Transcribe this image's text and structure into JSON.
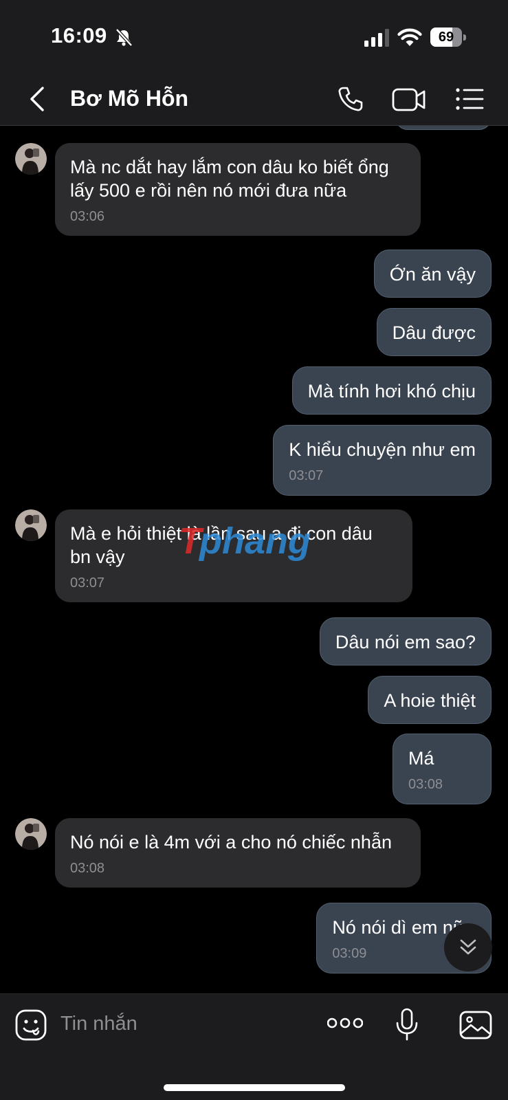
{
  "status_bar": {
    "time": "16:09",
    "battery": "69",
    "battery_level": 0.69
  },
  "header": {
    "contact_name": "Bơ Mõ Hỗn"
  },
  "messages": [
    {
      "sender": "them",
      "text": "Mà nc dắt hay lắm con dâu ko biết ổng lấy 500 e rồi nên nó mới đưa nữa",
      "time": "03:06",
      "avatar": true
    },
    {
      "sender": "me",
      "text": "Ớn ăn vậy",
      "time": ""
    },
    {
      "sender": "me",
      "text": "Dâu được",
      "time": ""
    },
    {
      "sender": "me",
      "text": "Mà tính hơi khó chịu",
      "time": ""
    },
    {
      "sender": "me",
      "text": "K hiểu chuyện như em",
      "time": "03:07"
    },
    {
      "sender": "them",
      "text": "Mà e hỏi thiệt là lần sau a đi con dâu bn vậy",
      "time": "03:07",
      "avatar": true
    },
    {
      "sender": "me",
      "text": "Dâu nói em sao?",
      "time": ""
    },
    {
      "sender": "me",
      "text": "A hoie thiệt",
      "time": ""
    },
    {
      "sender": "me",
      "text": "Má",
      "time": "03:08"
    },
    {
      "sender": "them",
      "text": "Nó nói e là 4m với a cho nó chiếc nhẫn",
      "time": "03:08",
      "avatar": true
    },
    {
      "sender": "me",
      "text": "Nó nói dì em nữa",
      "time": "03:09"
    }
  ],
  "watermark": "Thphang",
  "input": {
    "placeholder": "Tin nhắn"
  },
  "colors": {
    "background": "#000000",
    "header": "#1c1c1e",
    "incoming_bubble": "#2c2c2e",
    "outgoing_bubble": "#3a4350",
    "timestamp": "#8e8e93"
  }
}
